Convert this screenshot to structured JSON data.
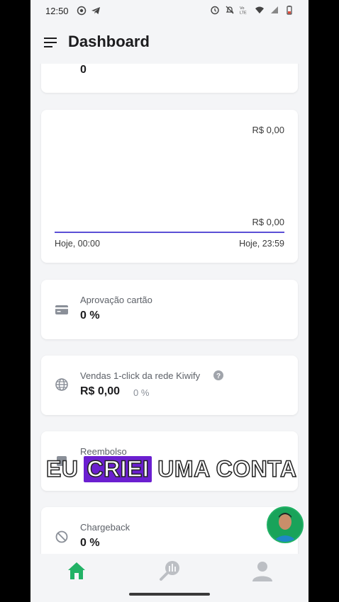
{
  "status": {
    "time": "12:50"
  },
  "appbar": {
    "title": "Dashboard"
  },
  "cards": {
    "top_value": "0",
    "chart": {
      "max_label": "R$  0,00",
      "min_label": "R$  0,00",
      "x_start": "Hoje, 00:00",
      "x_end": "Hoje, 23:59"
    },
    "approval": {
      "label": "Aprovação cartão",
      "value": "0 %"
    },
    "oneclick": {
      "label": "Vendas 1-click da rede Kiwify",
      "value": "R$ 0,00",
      "percent": "0 %"
    },
    "refund": {
      "label": "Reembolso"
    },
    "chargeback": {
      "label": "Chargeback",
      "value": "0 %"
    }
  },
  "caption": {
    "word1": "EU",
    "word2": "CRIEI",
    "word3": "UMA",
    "word4": "CONTA"
  },
  "chart_data": {
    "type": "line",
    "x": [
      "Hoje, 00:00",
      "Hoje, 23:59"
    ],
    "series": [
      {
        "values": [
          0,
          0
        ]
      }
    ],
    "ylim": [
      0,
      0
    ],
    "colors": {
      "line": "#5b4fd6"
    }
  },
  "colors": {
    "accent": "#5b4fd6",
    "nav_active": "#22b266"
  },
  "icons": {
    "menu": "hamburger-icon",
    "card": "credit-card-icon",
    "globe": "globe-icon",
    "help": "help-icon",
    "block": "block-icon",
    "home": "home-icon",
    "reports": "reports-icon",
    "profile": "profile-icon"
  }
}
